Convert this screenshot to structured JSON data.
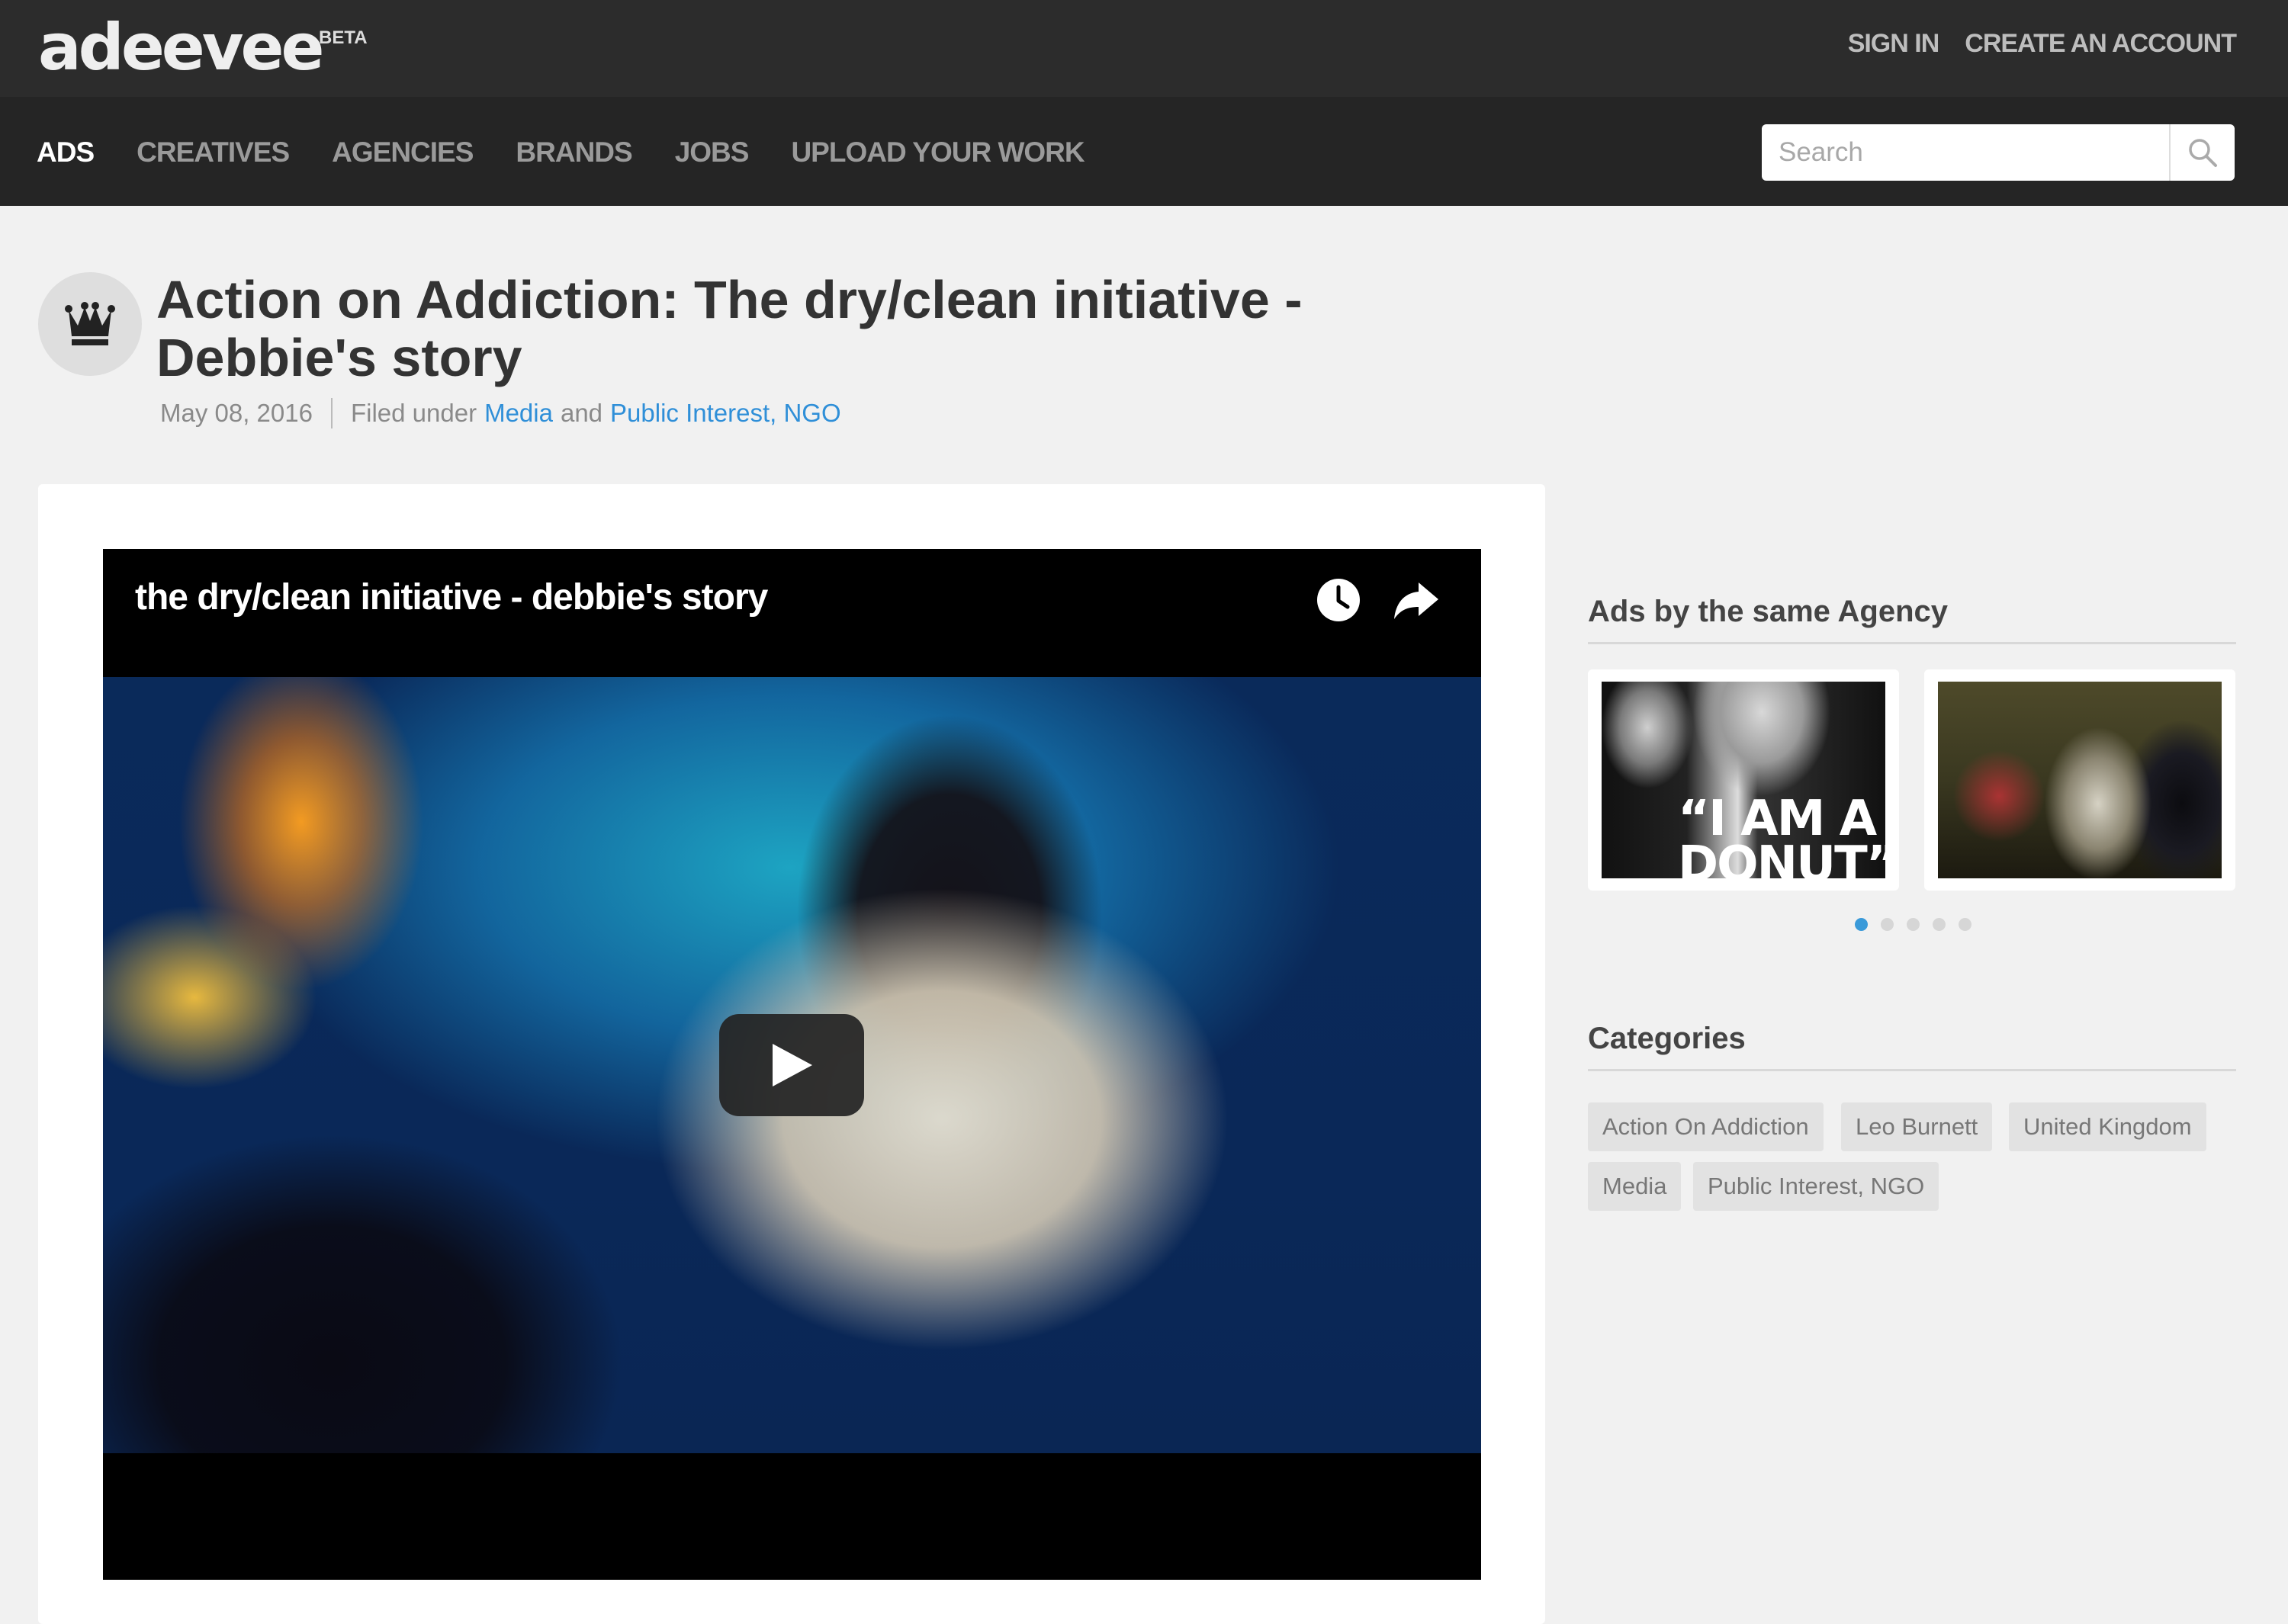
{
  "brand": {
    "logo_text": "adeevee",
    "beta_label": "BETA"
  },
  "account": {
    "sign_in": "SIGN IN",
    "create_account": "CREATE AN ACCOUNT"
  },
  "nav": {
    "items": [
      {
        "label": "ADS",
        "active": true
      },
      {
        "label": "CREATIVES",
        "active": false
      },
      {
        "label": "AGENCIES",
        "active": false
      },
      {
        "label": "BRANDS",
        "active": false
      },
      {
        "label": "JOBS",
        "active": false
      },
      {
        "label": "UPLOAD YOUR WORK",
        "active": false
      }
    ]
  },
  "search": {
    "placeholder": "Search",
    "value": "",
    "icon": "search-icon"
  },
  "article": {
    "badge_icon": "crown-icon",
    "title": "Action on Addiction: The dry/clean initiative - Debbie's story",
    "date": "May 08, 2016",
    "filed_under_prefix": "Filed under",
    "category_1": "Media",
    "conjunction": "and",
    "category_2": "Public Interest, NGO"
  },
  "video": {
    "title": "the dry/clean initiative - debbie's story",
    "icons": [
      "clock-icon",
      "share-icon",
      "play-icon"
    ]
  },
  "sidebar": {
    "same_agency_heading": "Ads by the same Agency",
    "thumbnails": [
      {
        "overlay_text": "“I AM A DONUT”"
      },
      {
        "overlay_text": ""
      }
    ],
    "carousel": {
      "total": 5,
      "active_index": 0
    },
    "categories_heading": "Categories",
    "tags": [
      "Action On Addiction",
      "Leo Burnett",
      "United Kingdom",
      "Media",
      "Public Interest, NGO"
    ]
  },
  "colors": {
    "topbar": "#2c2c2c",
    "navbar": "#252525",
    "link": "#2f8fd8",
    "carousel_active": "#3a9ad9",
    "page_bg": "#f1f1f1"
  }
}
